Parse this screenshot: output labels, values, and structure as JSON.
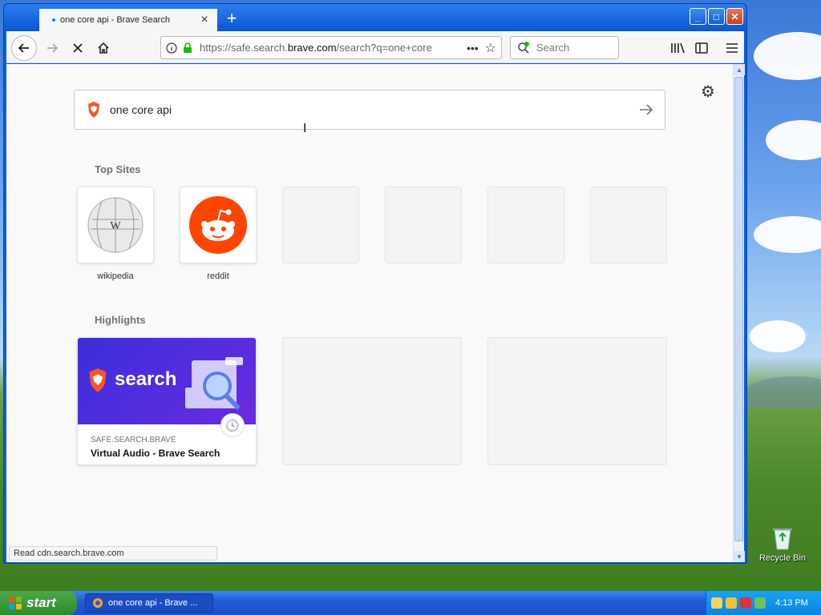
{
  "browser": {
    "tab_title": "one core api - Brave Search",
    "url_prefix": "https://safe.search.",
    "url_domain": "brave.com",
    "url_suffix": "/search?q=one+core",
    "search_placeholder": "Search",
    "status_text": "Read cdn.search.brave.com"
  },
  "page": {
    "query": "one core api",
    "top_sites_title": "Top Sites",
    "highlights_title": "Highlights",
    "top_sites": [
      {
        "label": "wikipedia"
      },
      {
        "label": "reddit"
      }
    ],
    "highlight": {
      "banner_word": "search",
      "source": "SAFE.SEARCH.BRAVE",
      "title": "Virtual Audio - Brave Search"
    }
  },
  "desktop": {
    "recycle_label": "Recycle Bin",
    "start_label": "start",
    "task_label": "one core api - Brave ...",
    "clock": "4:13 PM"
  },
  "colors": {
    "brave_orange": "#fb542b",
    "reddit_orange": "#ff4500",
    "highlight_purple": "#3b2fd9"
  }
}
